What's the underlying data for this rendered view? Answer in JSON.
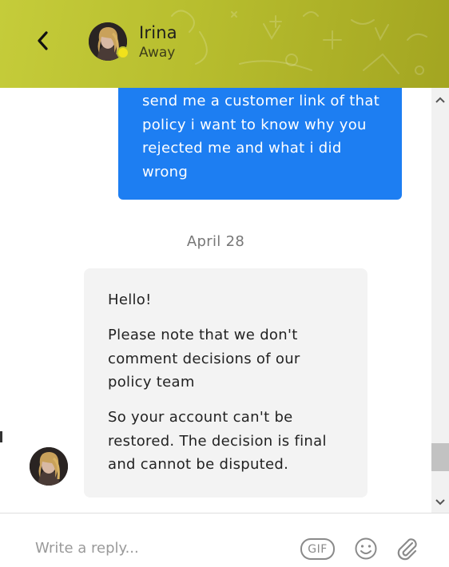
{
  "header": {
    "contact_name": "Irina",
    "contact_status": "Away",
    "background_color": "#bcc233",
    "status_dot_color": "#f2e21b",
    "icons": {
      "back": "chevron-left-icon"
    }
  },
  "conversation": {
    "outgoing_message": "send me a customer link of that\npolicy i want to know why you\nrejected me and what i did\nwrong",
    "outgoing_bubble_color": "#1d7ef2",
    "date_separator": "April 28",
    "incoming_message": {
      "paragraphs": [
        "Hello!",
        "Please note that we don't\ncomment decisions of our\npolicy team",
        "So your account can't be\nrestored. The decision is final\nand cannot be disputed."
      ],
      "bubble_color": "#f3f3f3"
    }
  },
  "composer": {
    "placeholder": "Write a reply...",
    "value": "",
    "gif_label": "GIF",
    "icons": {
      "emoji": "smiley-icon",
      "attach": "paperclip-icon"
    }
  },
  "scrollbar": {
    "icons": {
      "up": "chevron-up-icon",
      "down": "chevron-down-icon"
    }
  }
}
